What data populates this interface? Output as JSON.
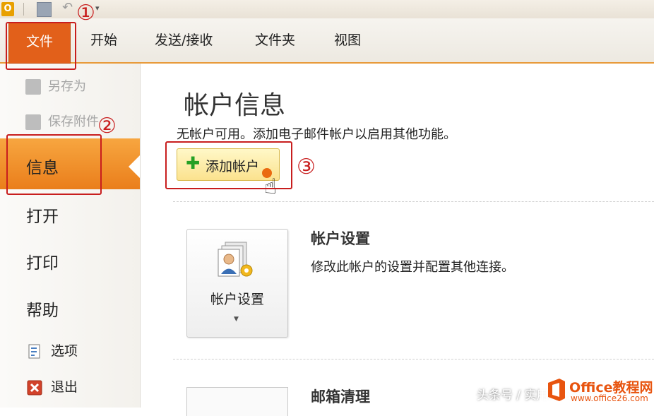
{
  "title_bar": {
    "app_icon_letter": "O"
  },
  "ribbon": {
    "tabs": [
      {
        "label": "文件"
      },
      {
        "label": "开始"
      },
      {
        "label": "发送/接收"
      },
      {
        "label": "文件夹"
      },
      {
        "label": "视图"
      }
    ],
    "accent_color": "#e2601a"
  },
  "nav": {
    "save_as": "另存为",
    "save_attachment": "保存附件",
    "info": "信息",
    "open": "打开",
    "print": "打印",
    "help": "帮助",
    "options": "选项",
    "exit": "退出"
  },
  "content": {
    "title": "帐户信息",
    "subtitle": "无帐户可用。添加电子邮件帐户以启用其他功能。",
    "add_account_label": "添加帐户",
    "account_settings": {
      "button_label": "帐户设置",
      "heading": "帐户设置",
      "description": "修改此帐户的设置并配置其他连接。"
    },
    "mailbox_cleanup_heading": "邮箱清理"
  },
  "annotations": {
    "step1": "①",
    "step2": "②",
    "step3": "③",
    "color": "#c81e1e"
  },
  "watermark": {
    "text": "头条号 / 实用办公技巧",
    "brand": "Office教程网",
    "url": "www.office26.com"
  }
}
